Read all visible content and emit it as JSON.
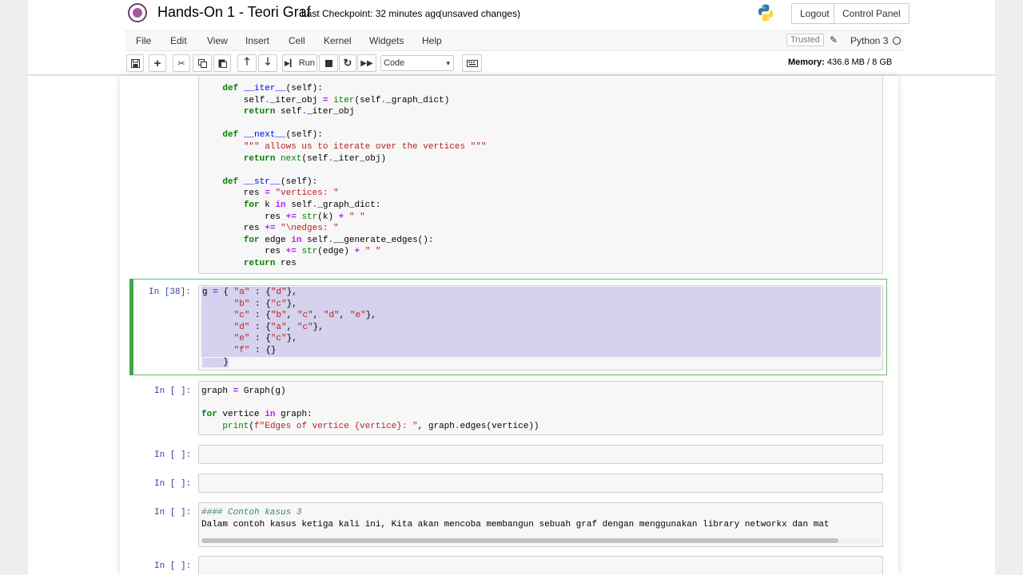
{
  "header": {
    "title": "Hands-On 1 - Teori Graf",
    "checkpoint": "Last Checkpoint: 32 minutes ago",
    "unsaved": "(unsaved changes)",
    "logout_label": "Logout",
    "control_panel_label": "Control Panel"
  },
  "menu": {
    "items": [
      "File",
      "Edit",
      "View",
      "Insert",
      "Cell",
      "Kernel",
      "Widgets",
      "Help"
    ],
    "trusted": "Trusted",
    "kernel": "Python 3"
  },
  "toolbar": {
    "run_label": "Run",
    "cell_type": "Code",
    "memory_label": "Memory:",
    "memory_value": "436.8 MB / 8 GB"
  },
  "cells": [
    {
      "prompt": "",
      "code": [
        "    def __iter__(self):",
        "        self._iter_obj = iter(self._graph_dict)",
        "        return self._iter_obj",
        "",
        "    def __next__(self):",
        "        \"\"\" allows us to iterate over the vertices \"\"\"",
        "        return next(self._iter_obj)",
        "",
        "    def __str__(self):",
        "        res = \"vertices: \"",
        "        for k in self._graph_dict:",
        "            res += str(k) + \" \"",
        "        res += \"\\nedges: \"",
        "        for edge in self.__generate_edges():",
        "            res += str(edge) + \" \"",
        "        return res"
      ]
    },
    {
      "prompt": "In [38]:",
      "code": [
        "g = { \"a\" : {\"d\"},",
        "      \"b\" : {\"c\"},",
        "      \"c\" : {\"b\", \"c\", \"d\", \"e\"},",
        "      \"d\" : {\"a\", \"c\"},",
        "      \"e\" : {\"c\"},",
        "      \"f\" : {}",
        "    }"
      ]
    },
    {
      "prompt": "In [ ]:",
      "code": [
        "graph = Graph(g)",
        "",
        "for vertice in graph:",
        "    print(f\"Edges of vertice {vertice}: \", graph.edges(vertice))"
      ]
    },
    {
      "prompt": "In [ ]:",
      "code": [
        ""
      ]
    },
    {
      "prompt": "In [ ]:",
      "code": [
        ""
      ]
    },
    {
      "prompt": "In [ ]:",
      "code": [
        "#### Contoh kasus 3",
        "Dalam contoh kasus ketiga kali ini, Kita akan mencoba membangun sebuah graf dengan menggunakan library networkx dan mat"
      ]
    },
    {
      "prompt": "In [ ]:",
      "code": [
        ""
      ]
    }
  ]
}
